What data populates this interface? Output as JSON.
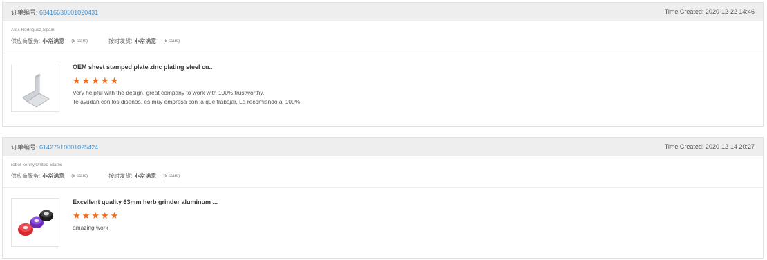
{
  "reviews": [
    {
      "order_label": "订单编号:",
      "order_number": "63416630501020431",
      "time_created": "Time Created: 2020-12-22 14:46",
      "buyer": "Alex Rodriguez,Spain",
      "supplier_service_label": "供应商服务:",
      "supplier_service_value": "非常满意",
      "supplier_service_stars": "(5 stars)",
      "on_time_label": "按时发货:",
      "on_time_value": "非常满意",
      "on_time_stars": "(5 stars)",
      "product_title": "OEM sheet stamped plate zinc plating steel cu..",
      "rating": 5,
      "review_lines": [
        "Very helpful with the design, great company to work with 100% trustworthy.",
        "Te ayudan con los diseños, es muy empresa con la que trabajar, La recomiendo al 100%"
      ],
      "thumbnail_icon": "bracket-product-icon"
    },
    {
      "order_label": "订单编号:",
      "order_number": "61427910001025424",
      "time_created": "Time Created: 2020-12-14 20:27",
      "buyer": "robot kenny,United States",
      "supplier_service_label": "供应商服务:",
      "supplier_service_value": "非常满意",
      "supplier_service_stars": "(5 stars)",
      "on_time_label": "按时发货:",
      "on_time_value": "非常满意",
      "on_time_stars": "(5 stars)",
      "product_title": "Excellent quality 63mm herb grinder aluminum ...",
      "rating": 5,
      "review_lines": [
        "amazing work"
      ],
      "thumbnail_icon": "grinder-product-icon"
    }
  ],
  "colors": {
    "star": "#f26a1b",
    "link": "#3d8fd1",
    "header_bg": "#eeeeee"
  }
}
